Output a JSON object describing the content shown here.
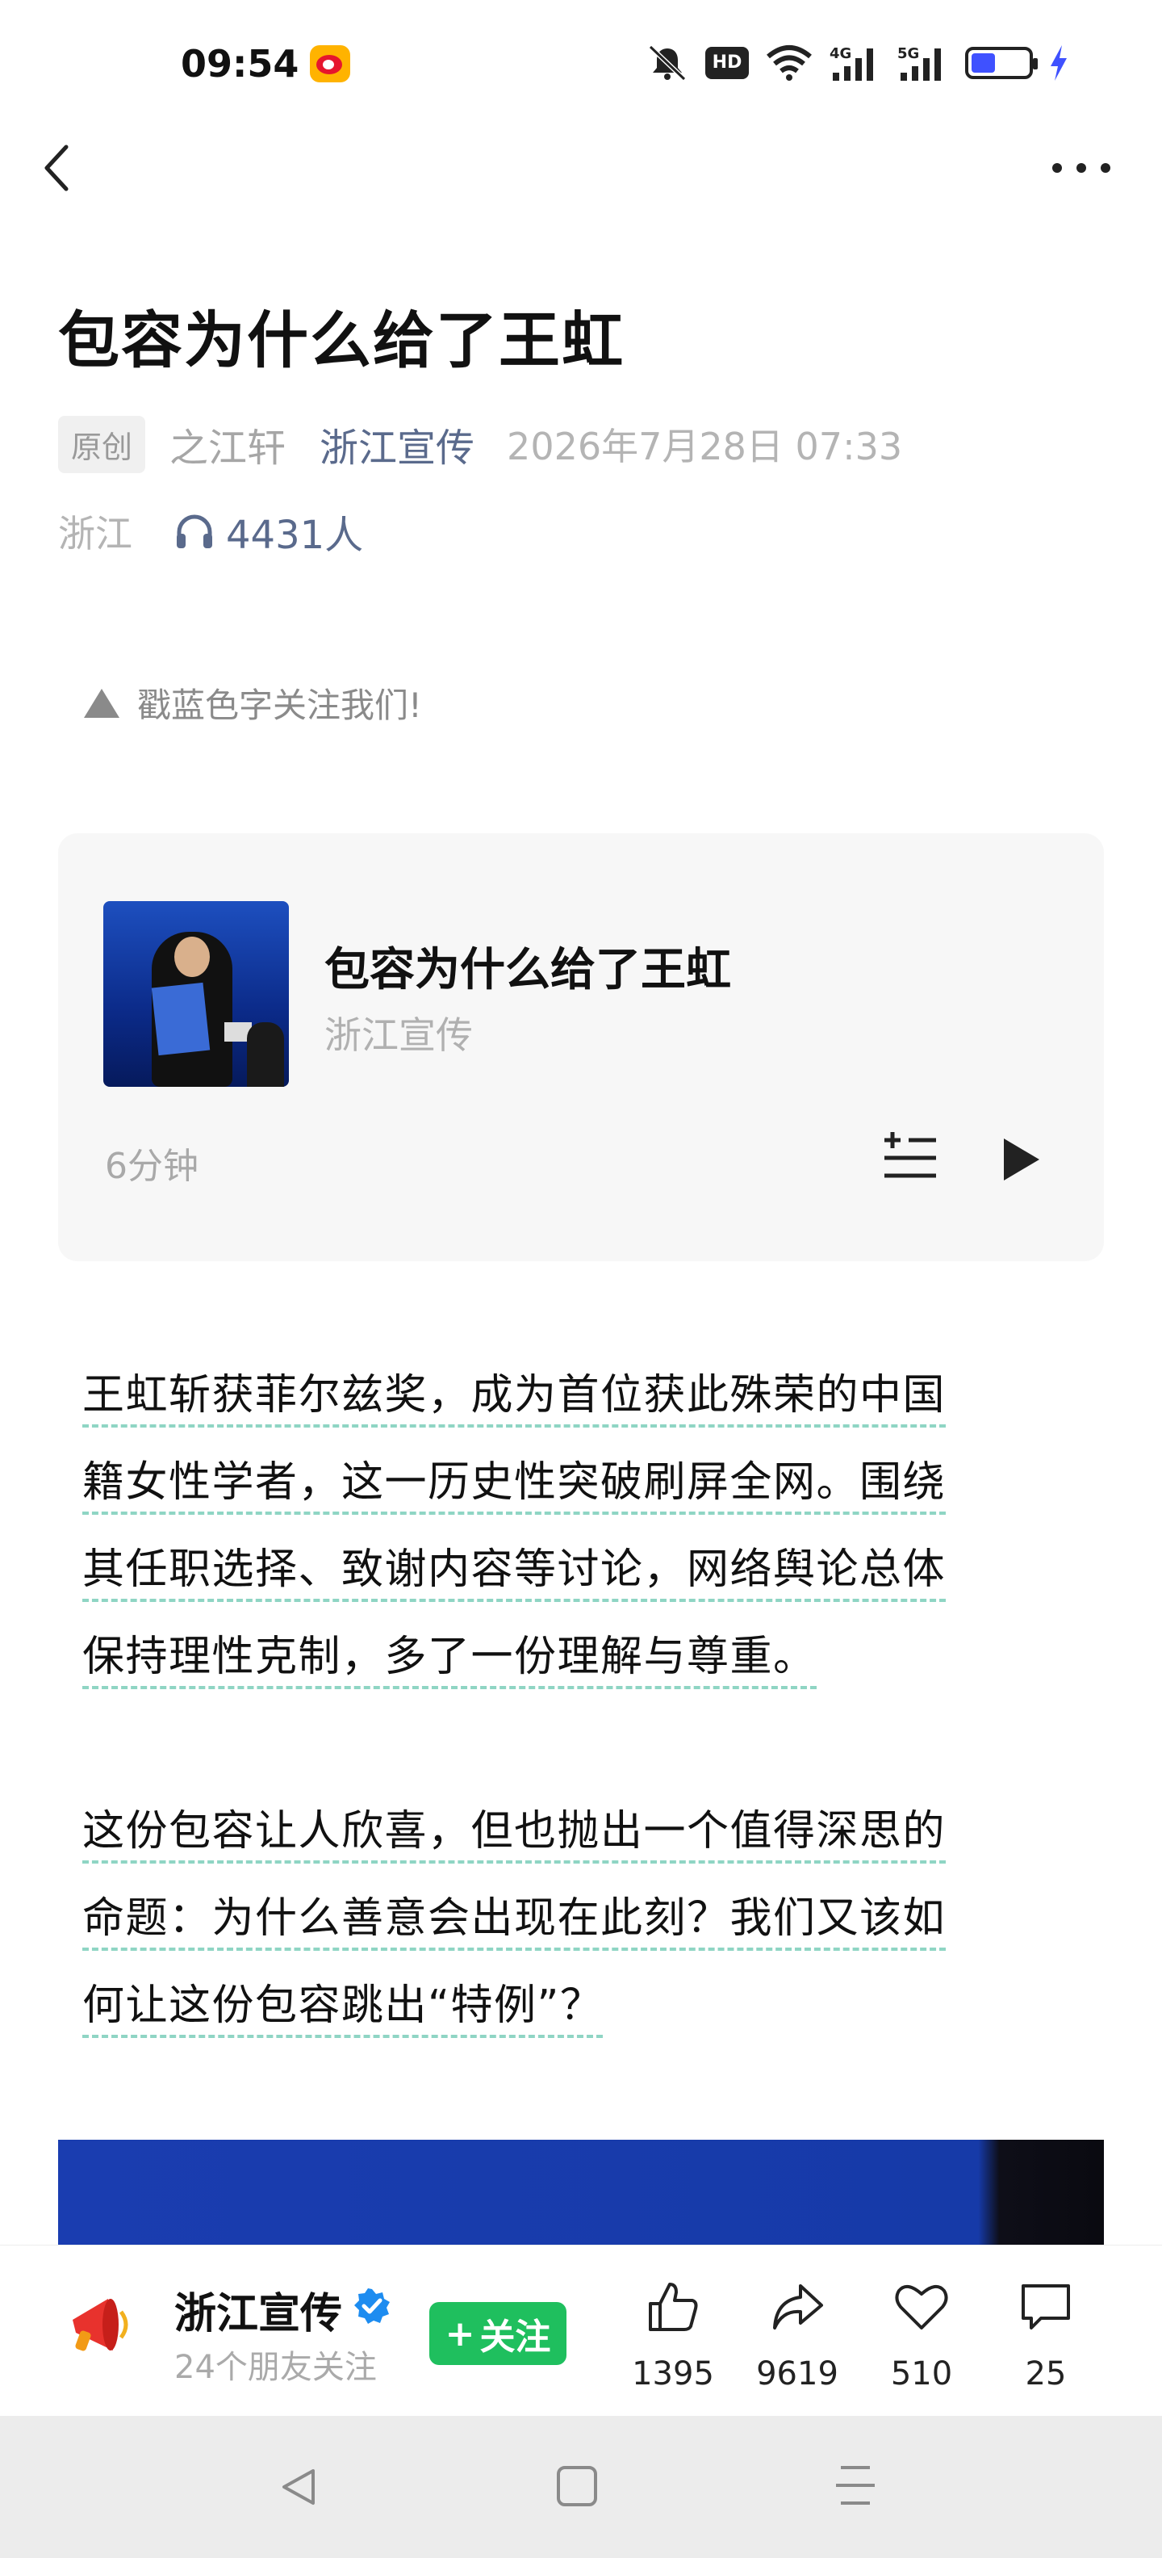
{
  "status_bar": {
    "time": "09:54",
    "icons": [
      "weibo-notification-icon",
      "mute-icon",
      "hd-icon",
      "wifi-icon",
      "4g-signal-icon",
      "5g-signal-icon",
      "battery-icon",
      "charging-bolt-icon"
    ],
    "hd_label": "HD"
  },
  "nav": {
    "back_icon": "chevron-left-icon",
    "more_icon": "more-dots-icon"
  },
  "article": {
    "title": "包容为什么给了王虹",
    "original_badge": "原创",
    "author": "之江轩",
    "account": "浙江宣传",
    "datetime": "2026年7月28日 07:33",
    "region": "浙江",
    "listeners": "4431人",
    "hint": "戳蓝色字关注我们!",
    "paragraphs": [
      [
        "王虹斩获菲尔兹奖，成为首位获此殊荣的中国",
        "籍女性学者，这一历史性突破刷屏全网。围绕",
        "其任职选择、致谢内容等讨论，网络舆论总体",
        "保持理性克制，多了一份理解与尊重。"
      ],
      [
        "这份包容让人欣喜，但也抛出一个值得深思的",
        "命题：为什么善意会出现在此刻？我们又该如",
        "何让这份包容跳出“特例”？"
      ]
    ]
  },
  "audio_card": {
    "title": "包容为什么给了王虹",
    "source": "浙江宣传",
    "duration": "6分钟"
  },
  "bottom_bar": {
    "account_name": "浙江宣传",
    "friends_follow": "24个朋友关注",
    "follow_label": "关注",
    "follow_plus": "+",
    "likes": "1395",
    "shares": "9619",
    "favorites": "510",
    "comments": "25",
    "accent_green": "#1fbf5e"
  },
  "colors": {
    "link_blue": "#5a6a8c",
    "meta_gray": "#b4b4b4",
    "underline_teal": "#8fd5c4"
  }
}
